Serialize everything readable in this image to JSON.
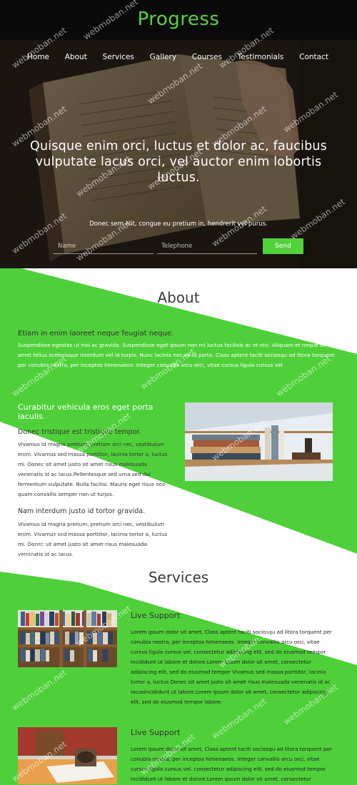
{
  "header": {
    "brand": "Progress"
  },
  "nav": {
    "items": [
      "Home",
      "About",
      "Services",
      "Gallery",
      "Courses",
      "Testimonials",
      "Contact"
    ]
  },
  "hero": {
    "title": "Quisque enim orci, luctus et dolor ac, faucibus vulputate lacus orci, vel auctor enim lobortis luctus.",
    "subtitle": "Donec sem elit, congue eu pretium in, hendrerit vel purus.",
    "name_placeholder": "Name",
    "phone_placeholder": "Telephone",
    "send_label": "Send"
  },
  "about": {
    "title": "About",
    "lead": "Etiam in enim laoreet neque feugiat neque.",
    "paragraph": "Suspendisse egestas ut nisi ac gravida. Suspendisse eget ipsum non mi luctus facilisis ac et nisi. Aliquam et neque sit amet tellus scelerisque interdum vel id turpis. Nunc lacinia nec ex id porta. Class aptent taciti sociosqu ad litora torquent per conubia nostra, per inceptos himenaeos. Integer convallis arcu orci, vitae cursus ligula cursus vel.",
    "sub_heading": "Curabitur vehicula eros eget porta iaculis.",
    "block1_lead": "Donec tristique est tristique tempor.",
    "block1_text": "Vivamus id magna pretium, pretium orci nec, vestibulum enim. Vivamus sed massa porttitor, lacinia tortor a, luctus mi. Donec sit amet justo sit amet risus malesuada venenatis id ac lacus.Pellentesque sed urna sed dui fermentum vulputate. Nulla facilisi. Mauris eget risus non quam convallis semper non ut turpis.",
    "block2_lead": "Nam interdum justo id tortor gravida.",
    "block2_text": "Vivamus id magna pretium, pretium orci nec, vestibulum enim. Vivamus sed massa porttitor, lacinia tortor a, luctus mi. Donec sit amet justo sit amet risus malesuada venenatis id ac lacus."
  },
  "services": {
    "title": "Services",
    "items": [
      {
        "heading": "Live Support",
        "text": "Lorem ipsum dolor sit amet, Class aptent taciti sociosqu ad litora torquent per conubia nostra, per inceptos himenaeos. Integer convallis arcu orci, vitae cursus ligula cursus vel. consectetur adipiscing elit, sed do eiusmod tempor incididunt ut labore et dolore.Lorem ipsum dolor sit amet, consectetur adipiscing elit, sed do eiusmod tempor Vivamus sed massa porttitor, lacinia tortor a, luctus Donec sit amet justo sit amet risus malesuada venenatis id ac lacusincididunt ut labore.Lorem ipsum dolor sit amet, consectetur adipiscing elit, sed do eiusmod tempor labore."
      },
      {
        "heading": "Live Support",
        "text": "Lorem ipsum dolor sit amet, Class aptent taciti sociosqu ad litora torquent per conubia nostra, per inceptos himenaeos. Integer convallis arcu orci, vitae cursus ligula cursus vel. consectetur adipiscing elit, sed do eiusmod tempor incididunt ut labore et dolore.Lorem ipsum dolor sit amet, consectetur"
      }
    ]
  },
  "watermark": "webmoban.net",
  "colors": {
    "accent": "#52d13a",
    "header_bg": "#0a0a0a"
  }
}
